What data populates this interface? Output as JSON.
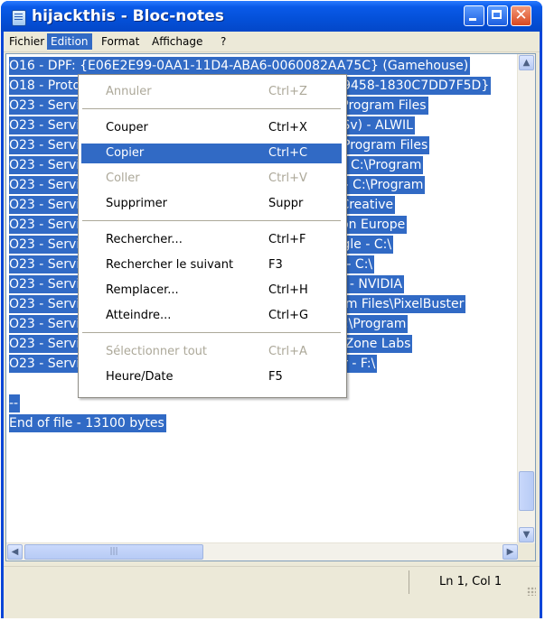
{
  "window": {
    "title": "hijackthis - Bloc-notes"
  },
  "menubar": {
    "items": [
      "Fichier",
      "Edition",
      "Format",
      "Affichage",
      "?"
    ]
  },
  "editor_lines": [
    "O16 - DPF: {E06E2E99-0AA1-11D4-ABA6-0060082AA75C} (Gamehouse)",
    "O18 - Protocol: skype4com - {FFC8B962-9B40-4DFF-9458-1830C7DD7F5D}",
    "O23 - Service: Apple Mobile Device - Apple, Inc. - C:\\Program Files",
    "O23 - Service: avast! iAVS4 Control Service (aswUpdSv) - ALWIL",
    "O23 - Service: avast! Antivirus - ALWIL Software - C:\\Program Files",
    "O23 - Service: avast! Mail Scanner - ALWIL Software - C:\\Program",
    "O23 - Service: avast! Web Scanner - ALWIL Software - C:\\Program",
    "O23 - Service: Creative Service for CDROM Access - Creative",
    "O23 - Service: FLEXnet Licensing Service - Macrovision Europe",
    "O23 - Service: Google Updater Service (gusvc) - Google - C:\\",
    "O23 - Service: iPod Service (iPodService) - Apple Inc. - C:\\",
    "O23 - Service: NVIDIA Display Driver Service (NVSvc) - NVIDIA",
    "O23 - Service: PnkBstrA - Unknown owner - C:\\Program Files\\PixelBuster",
    "O23 - Service: Sandboxie Service (SbieSvc) - tzuk - C:\\Program",
    "O23 - Service: TrueVector Internet Monitor (vsmon) - Zone Labs",
    "O23 - Service: VNC Server (winvnc) - Unknown owner - F:\\",
    "",
    "--",
    "End of file - 13100 bytes"
  ],
  "dropdown": {
    "items": [
      {
        "label": "Annuler",
        "shortcut": "Ctrl+Z",
        "state": "disabled"
      },
      {
        "label": "Couper",
        "shortcut": "Ctrl+X",
        "state": "normal"
      },
      {
        "label": "Copier",
        "shortcut": "Ctrl+C",
        "state": "highlighted"
      },
      {
        "label": "Coller",
        "shortcut": "Ctrl+V",
        "state": "disabled"
      },
      {
        "label": "Supprimer",
        "shortcut": "Suppr",
        "state": "normal"
      },
      {
        "label": "Rechercher...",
        "shortcut": "Ctrl+F",
        "state": "normal"
      },
      {
        "label": "Rechercher le suivant",
        "shortcut": "F3",
        "state": "normal"
      },
      {
        "label": "Remplacer...",
        "shortcut": "Ctrl+H",
        "state": "normal"
      },
      {
        "label": "Atteindre...",
        "shortcut": "Ctrl+G",
        "state": "normal"
      },
      {
        "label": "Sélectionner tout",
        "shortcut": "Ctrl+A",
        "state": "disabled"
      },
      {
        "label": "Heure/Date",
        "shortcut": "F5",
        "state": "normal"
      }
    ]
  },
  "status": {
    "position": "Ln 1, Col 1"
  },
  "icons": {
    "app": "notepad-icon",
    "minimize": "minimize-icon",
    "maximize": "maximize-icon",
    "close": "close-icon",
    "scroll_up": "arrow-up-icon",
    "scroll_down": "arrow-down-icon",
    "scroll_left": "arrow-left-icon",
    "scroll_right": "arrow-right-icon",
    "close_glyph": "✕",
    "up_glyph": "▲",
    "down_glyph": "▼",
    "left_glyph": "◀",
    "right_glyph": "▶",
    "grip_glyph": "|||"
  },
  "colors": {
    "selection": "#316ac5",
    "titlebar": "#0450d8",
    "disabled_text": "#aca899"
  }
}
